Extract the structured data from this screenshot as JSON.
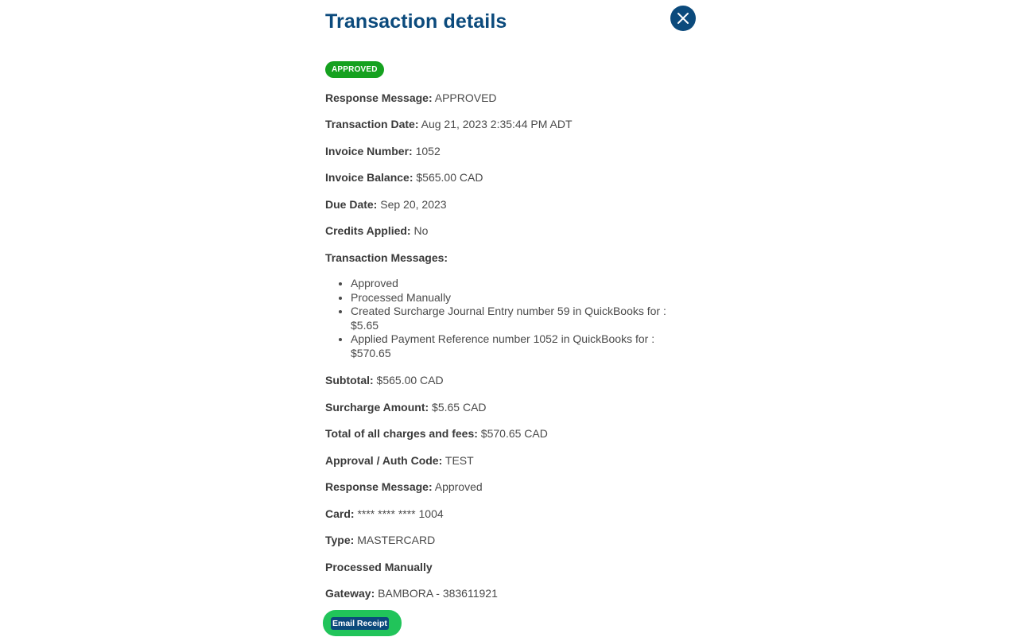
{
  "header": {
    "title": "Transaction details",
    "close_icon": "close-icon"
  },
  "status_badge": "APPROVED",
  "colors": {
    "title": "#0b4a7c",
    "badge": "#15a11f",
    "close_button": "#0b4a7c",
    "email_button": "#21c45a"
  },
  "details": {
    "response_message": {
      "label": "Response Message:",
      "value": "APPROVED"
    },
    "transaction_date": {
      "label": "Transaction Date:",
      "value": "Aug 21, 2023 2:35:44 PM ADT"
    },
    "invoice_number": {
      "label": "Invoice Number:",
      "value": "1052"
    },
    "invoice_balance": {
      "label": "Invoice Balance:",
      "value": "$565.00 CAD"
    },
    "due_date": {
      "label": "Due Date:",
      "value": "Sep 20, 2023"
    },
    "credits_applied": {
      "label": "Credits Applied:",
      "value": "No"
    },
    "transaction_messages_label": "Transaction Messages:"
  },
  "transaction_messages": [
    "Approved",
    "Processed Manually",
    "Created Surcharge Journal Entry number 59 in QuickBooks for : $5.65",
    "Applied Payment Reference number 1052 in QuickBooks for : $570.65"
  ],
  "summary": {
    "subtotal": {
      "label": "Subtotal:",
      "value": "$565.00 CAD"
    },
    "surcharge_amount": {
      "label": "Surcharge Amount:",
      "value": "$5.65 CAD"
    },
    "total_charges": {
      "label": "Total of all charges and fees:",
      "value": "$570.65 CAD"
    },
    "approval_code": {
      "label": "Approval / Auth Code:",
      "value": "TEST"
    },
    "response_message": {
      "label": "Response Message:",
      "value": "Approved"
    },
    "card": {
      "label": "Card:",
      "value": "**** **** **** 1004"
    },
    "type": {
      "label": "Type:",
      "value": "MASTERCARD"
    },
    "processed_manually": "Processed Manually",
    "gateway": {
      "label": "Gateway:",
      "value": "BAMBORA - 383611921"
    }
  },
  "actions": {
    "email_receipt": "Email Receipt"
  }
}
